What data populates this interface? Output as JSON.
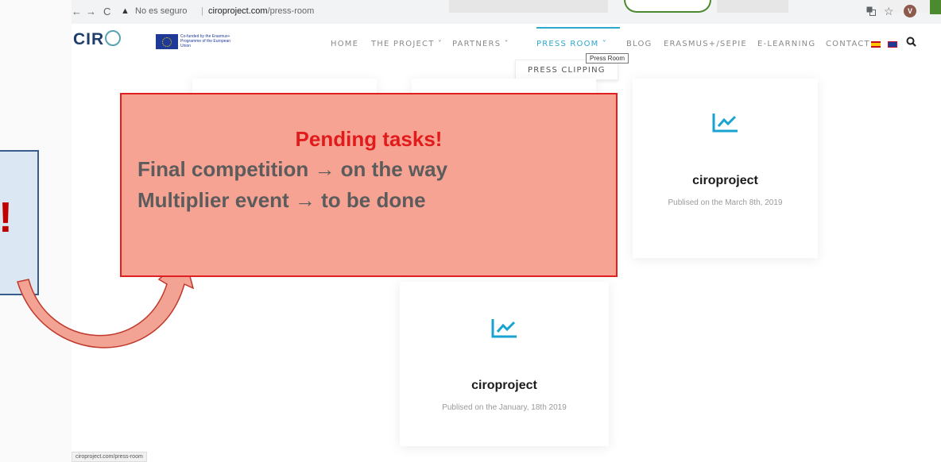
{
  "browser": {
    "insecure_label": "No es seguro",
    "separator": "|",
    "url_domain": "ciroproject.com",
    "url_path": "/press-room",
    "avatar_initial": "V",
    "back_icon": "←",
    "forward_icon": "→",
    "reload_icon": "C",
    "warning_icon": "▲",
    "star_icon": "☆"
  },
  "site": {
    "logo_text": "CIR",
    "eu_text": "Co-funded by the Erasmus+ Programme of the European Union",
    "nav": [
      {
        "label": "HOME"
      },
      {
        "label": "THE PROJECT ˅"
      },
      {
        "label": "PARTNERS ˅"
      },
      {
        "label": "PRESS ROOM ˅"
      },
      {
        "label": "BLOG"
      },
      {
        "label": "ERASMUS+/SEPIE"
      },
      {
        "label": "E-LEARNING"
      },
      {
        "label": "CONTACT"
      }
    ],
    "active_color": "#2ea7cc",
    "dropdown_item": "PRESS CLIPPING",
    "tooltip": "Press Room"
  },
  "cards": [
    {
      "title": "ciroproject",
      "date": "Publised on the March 8th, 2019",
      "icon": "chart-up-icon"
    },
    {
      "title": "ciroproject",
      "date": "Publised on the January, 18th 2019",
      "icon": "chart-up-icon"
    }
  ],
  "overlay": {
    "title": "Pending tasks!",
    "line1": "Final competition → on the way",
    "line2": "Multiplier event → to be done",
    "title_color": "#e11b1b",
    "box_color": "#f7a394",
    "note_mark": "!"
  },
  "status_bar": "ciroproject.com/press-room"
}
